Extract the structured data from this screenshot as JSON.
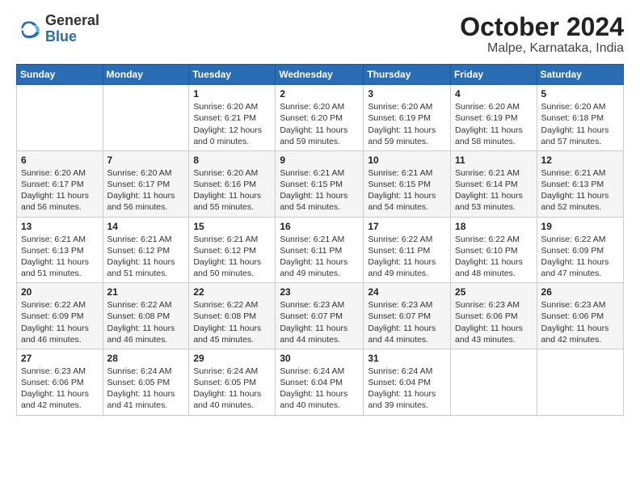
{
  "logo": {
    "general": "General",
    "blue": "Blue"
  },
  "title": "October 2024",
  "subtitle": "Malpe, Karnataka, India",
  "columns": [
    "Sunday",
    "Monday",
    "Tuesday",
    "Wednesday",
    "Thursday",
    "Friday",
    "Saturday"
  ],
  "weeks": [
    [
      {
        "day": "",
        "info": ""
      },
      {
        "day": "",
        "info": ""
      },
      {
        "day": "1",
        "info": "Sunrise: 6:20 AM\nSunset: 6:21 PM\nDaylight: 12 hours\nand 0 minutes."
      },
      {
        "day": "2",
        "info": "Sunrise: 6:20 AM\nSunset: 6:20 PM\nDaylight: 11 hours\nand 59 minutes."
      },
      {
        "day": "3",
        "info": "Sunrise: 6:20 AM\nSunset: 6:19 PM\nDaylight: 11 hours\nand 59 minutes."
      },
      {
        "day": "4",
        "info": "Sunrise: 6:20 AM\nSunset: 6:19 PM\nDaylight: 11 hours\nand 58 minutes."
      },
      {
        "day": "5",
        "info": "Sunrise: 6:20 AM\nSunset: 6:18 PM\nDaylight: 11 hours\nand 57 minutes."
      }
    ],
    [
      {
        "day": "6",
        "info": "Sunrise: 6:20 AM\nSunset: 6:17 PM\nDaylight: 11 hours\nand 56 minutes."
      },
      {
        "day": "7",
        "info": "Sunrise: 6:20 AM\nSunset: 6:17 PM\nDaylight: 11 hours\nand 56 minutes."
      },
      {
        "day": "8",
        "info": "Sunrise: 6:20 AM\nSunset: 6:16 PM\nDaylight: 11 hours\nand 55 minutes."
      },
      {
        "day": "9",
        "info": "Sunrise: 6:21 AM\nSunset: 6:15 PM\nDaylight: 11 hours\nand 54 minutes."
      },
      {
        "day": "10",
        "info": "Sunrise: 6:21 AM\nSunset: 6:15 PM\nDaylight: 11 hours\nand 54 minutes."
      },
      {
        "day": "11",
        "info": "Sunrise: 6:21 AM\nSunset: 6:14 PM\nDaylight: 11 hours\nand 53 minutes."
      },
      {
        "day": "12",
        "info": "Sunrise: 6:21 AM\nSunset: 6:13 PM\nDaylight: 11 hours\nand 52 minutes."
      }
    ],
    [
      {
        "day": "13",
        "info": "Sunrise: 6:21 AM\nSunset: 6:13 PM\nDaylight: 11 hours\nand 51 minutes."
      },
      {
        "day": "14",
        "info": "Sunrise: 6:21 AM\nSunset: 6:12 PM\nDaylight: 11 hours\nand 51 minutes."
      },
      {
        "day": "15",
        "info": "Sunrise: 6:21 AM\nSunset: 6:12 PM\nDaylight: 11 hours\nand 50 minutes."
      },
      {
        "day": "16",
        "info": "Sunrise: 6:21 AM\nSunset: 6:11 PM\nDaylight: 11 hours\nand 49 minutes."
      },
      {
        "day": "17",
        "info": "Sunrise: 6:22 AM\nSunset: 6:11 PM\nDaylight: 11 hours\nand 49 minutes."
      },
      {
        "day": "18",
        "info": "Sunrise: 6:22 AM\nSunset: 6:10 PM\nDaylight: 11 hours\nand 48 minutes."
      },
      {
        "day": "19",
        "info": "Sunrise: 6:22 AM\nSunset: 6:09 PM\nDaylight: 11 hours\nand 47 minutes."
      }
    ],
    [
      {
        "day": "20",
        "info": "Sunrise: 6:22 AM\nSunset: 6:09 PM\nDaylight: 11 hours\nand 46 minutes."
      },
      {
        "day": "21",
        "info": "Sunrise: 6:22 AM\nSunset: 6:08 PM\nDaylight: 11 hours\nand 46 minutes."
      },
      {
        "day": "22",
        "info": "Sunrise: 6:22 AM\nSunset: 6:08 PM\nDaylight: 11 hours\nand 45 minutes."
      },
      {
        "day": "23",
        "info": "Sunrise: 6:23 AM\nSunset: 6:07 PM\nDaylight: 11 hours\nand 44 minutes."
      },
      {
        "day": "24",
        "info": "Sunrise: 6:23 AM\nSunset: 6:07 PM\nDaylight: 11 hours\nand 44 minutes."
      },
      {
        "day": "25",
        "info": "Sunrise: 6:23 AM\nSunset: 6:06 PM\nDaylight: 11 hours\nand 43 minutes."
      },
      {
        "day": "26",
        "info": "Sunrise: 6:23 AM\nSunset: 6:06 PM\nDaylight: 11 hours\nand 42 minutes."
      }
    ],
    [
      {
        "day": "27",
        "info": "Sunrise: 6:23 AM\nSunset: 6:06 PM\nDaylight: 11 hours\nand 42 minutes."
      },
      {
        "day": "28",
        "info": "Sunrise: 6:24 AM\nSunset: 6:05 PM\nDaylight: 11 hours\nand 41 minutes."
      },
      {
        "day": "29",
        "info": "Sunrise: 6:24 AM\nSunset: 6:05 PM\nDaylight: 11 hours\nand 40 minutes."
      },
      {
        "day": "30",
        "info": "Sunrise: 6:24 AM\nSunset: 6:04 PM\nDaylight: 11 hours\nand 40 minutes."
      },
      {
        "day": "31",
        "info": "Sunrise: 6:24 AM\nSunset: 6:04 PM\nDaylight: 11 hours\nand 39 minutes."
      },
      {
        "day": "",
        "info": ""
      },
      {
        "day": "",
        "info": ""
      }
    ]
  ]
}
